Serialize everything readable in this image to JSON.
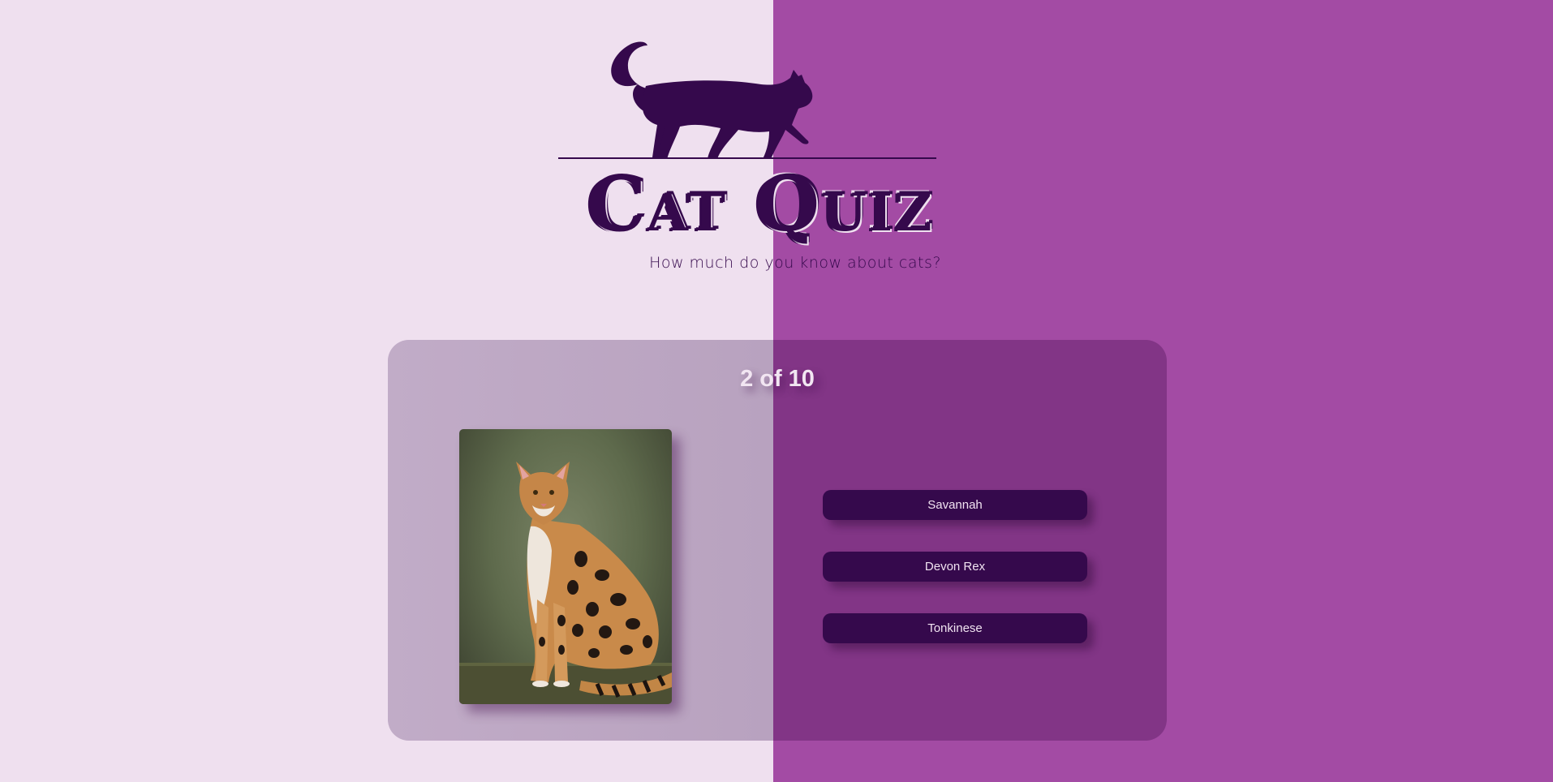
{
  "header": {
    "title": "Cat Quiz",
    "subtitle": "How much do you know about cats?"
  },
  "quiz": {
    "progress": "2 of 10",
    "answers": [
      {
        "label": "Savannah"
      },
      {
        "label": "Devon Rex"
      },
      {
        "label": "Tonkinese"
      }
    ]
  },
  "icons": {
    "logo": "walking-cat-silhouette-icon",
    "photo": "savannah-cat-photo"
  },
  "colors": {
    "left_bg": "#efe0ef",
    "right_bg": "#a34ba4",
    "dark_purple": "#35094c",
    "card_left": "#b8a2bf",
    "card_right": "#823586"
  }
}
